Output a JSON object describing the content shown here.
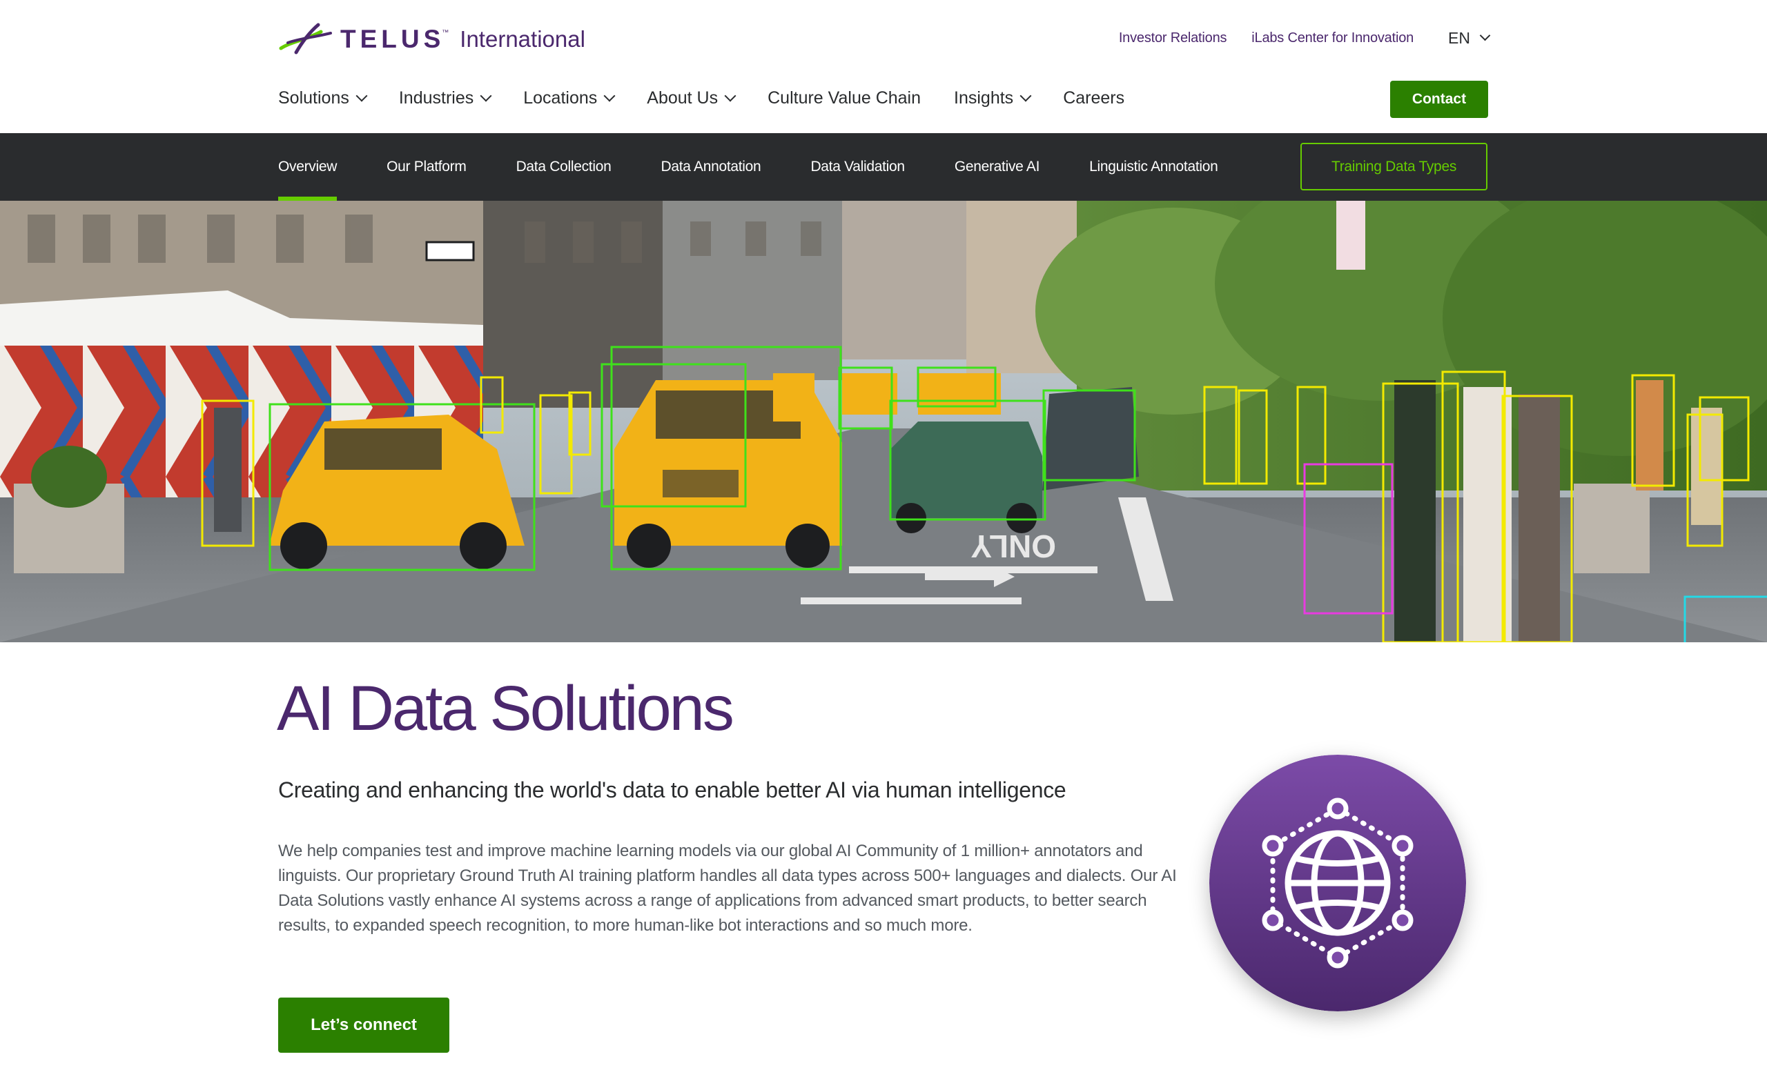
{
  "brand": {
    "wordmark": "TELUS",
    "subtitle": "International",
    "purple": "#4B286D",
    "green": "#2B8000",
    "bright_green": "#66CC00"
  },
  "utility_nav": {
    "links": [
      "Investor Relations",
      "iLabs Center for Innovation"
    ],
    "language": "EN"
  },
  "main_nav": {
    "items": [
      {
        "label": "Solutions",
        "has_dropdown": true
      },
      {
        "label": "Industries",
        "has_dropdown": true
      },
      {
        "label": "Locations",
        "has_dropdown": true
      },
      {
        "label": "About Us",
        "has_dropdown": true
      },
      {
        "label": "Culture Value Chain",
        "has_dropdown": false
      },
      {
        "label": "Insights",
        "has_dropdown": true
      },
      {
        "label": "Careers",
        "has_dropdown": false
      }
    ],
    "contact_label": "Contact"
  },
  "sub_nav": {
    "items": [
      {
        "label": "Overview",
        "active": true
      },
      {
        "label": "Our Platform",
        "active": false
      },
      {
        "label": "Data Collection",
        "active": false
      },
      {
        "label": "Data Annotation",
        "active": false
      },
      {
        "label": "Data Validation",
        "active": false
      },
      {
        "label": "Generative AI",
        "active": false
      },
      {
        "label": "Linguistic Annotation",
        "active": false
      }
    ],
    "highlight_button": "Training Data Types"
  },
  "hero": {
    "image": "street-scene-with-annotation-bounding-boxes",
    "road_marking": "ONLY"
  },
  "content": {
    "title": "AI Data Solutions",
    "subtitle": "Creating and enhancing the world's data to enable better AI via human intelligence",
    "body": "We help companies test and improve machine learning models via our global AI Community of 1 million+ annotators and linguists. Our proprietary Ground Truth AI training platform handles all data types across 500+ languages and dialects. Our AI Data Solutions vastly enhance AI systems across a range of applications from advanced smart products, to better search results, to expanded speech recognition, to more human-like bot interactions and so much more.",
    "cta_label": "Let’s connect",
    "icon": "globe-network-icon"
  }
}
